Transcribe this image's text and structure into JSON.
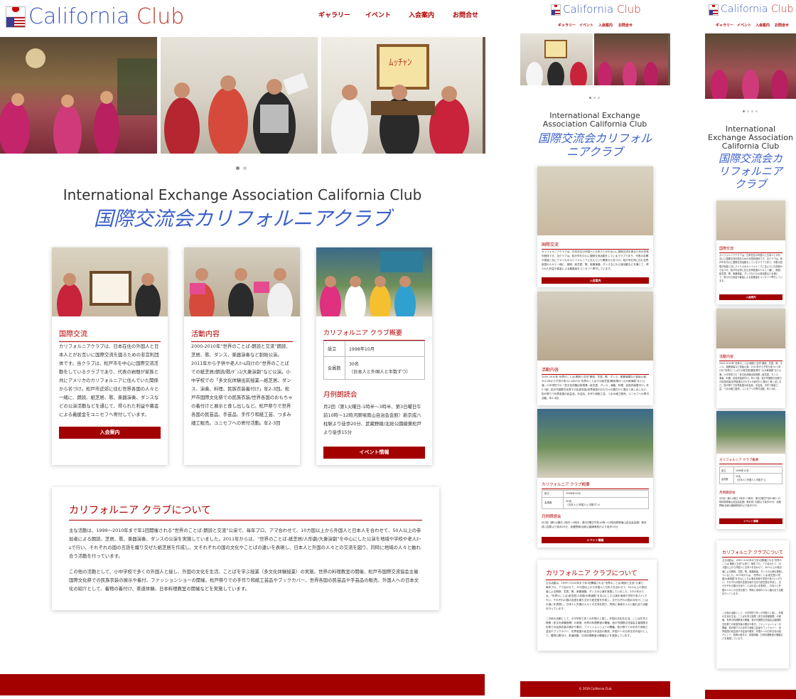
{
  "brand": {
    "logo_word1": "California",
    "logo_word2": "Club",
    "accent_color": "#a30000",
    "title_blue": "#3a5fc8"
  },
  "nav": [
    {
      "label": "ギャラリー"
    },
    {
      "label": "イベント"
    },
    {
      "label": "入会案内"
    },
    {
      "label": "お問合せ"
    }
  ],
  "hero": {
    "title_en": "International Exchange Association California Club",
    "title_jp": "国際交流会カリフォルニアクラブ",
    "mobile_title_en_line1": "International Exchange",
    "mobile_title_en_line2": "Association California Club",
    "mobile_title_jp_line1": "国際交流会カリフォル",
    "mobile_title_jp_line2": "ニアクラブ",
    "narrow_title_en_line1": "International",
    "narrow_title_en_line2": "Exchange Association",
    "narrow_title_en_line3": "California Club",
    "narrow_title_jp_line1": "国際交流会カ",
    "narrow_title_jp_line2": "リフォルニア",
    "narrow_title_jp_line3": "クラブ"
  },
  "cards": {
    "exchange": {
      "heading": "国際交流",
      "body": "カリフォルニアクラブは、日本在住の外国人と日本人とがお互いに国際交流を図るための非営利団体です。当クラブは、松戸市を中心に国際交流活動をしているクラブであり、代表の岩間が家族と共にアメリカのカリフォルニアに住んでいた関係から名づけ。松戸市近郊に住む世界各国の人々と一緒に、朗読、紙芝居、歌、楽器演奏、ダンスなどの公演活動などを通じて、得られた利益や募金による義援金をユニセフへ寄付しています。",
      "button": "入会案内"
    },
    "activity": {
      "heading": "活動内容",
      "body": "2000-2010年“世界のことば-朗読と交流”朗読、芝居、歌、ダンス、楽器演奏など創始公演。2011年から子供や老人ﾎｰﾑ向けの“世界のことばでの紙芝居/朗読/歌/ﾀﾞﾝｽ/大衆演劇”など公演。小中学校での「多文化体験出前授業―紙芝居、ダンス、演奏、料理、民族衣装着付け」年2-3回。松戸市国際文化祭での民族衣装/世界各国のおもちゃの着付けと展示と食し出しなど。松戸祭りで世界各国の民芸品、手芸品、手作り和紙工芸、つまみ細工販売。ユニセフへの寄付活動。年2-3回"
    },
    "overview": {
      "heading": "カリフォルニア クラブ概要",
      "row1_label": "設立",
      "row1_value": "1998年10月",
      "row2_label": "会員数",
      "row2_value": "30名",
      "row2_note": "（日本人と外国人と半数ずつ）",
      "reading_heading": "月例朗読会",
      "reading_body": "月2回（第1火曜日-1時半〜3時半、第3日曜日午前10時〜12時河原塚南山自治会会館）新京成八柱駅より徒歩20分、武蔵野線/北総公園線東松戸より徒歩15分",
      "button": "イベント情報"
    }
  },
  "about": {
    "heading": "カリフォルニア クラブについて",
    "para1": "主な活動は、1999〜2010年まで年1回開催される“世界のことば-朗読と交流”公演で、毎年プロ、アマ合わせて、10カ国以上から外国人と日本人を合わせて、50人以上の参加者による朗読、芝居、歌、楽器演奏、ダンスの公演を実施していました。2011年からは、“世界のことば-紙芝居/人形劇/大衆演劇”を中心にした公演を地域や学校や老人ﾎｰﾑで行い、それぞれの国の言語を織り交ぜた紙芝居を作成し、文それぞれの国の文化やことばの違いを表現し、日本人と外国の人々との交流を図り、同時に地域の人々と触れ合う活動を行っています。",
    "para2": "この他の活動として、小中学校で多くの外国人と接し、外国の文化を生活、ことばを学ぶ授業（多文化体験授業）の実施、世界の料理教室の開催、松戸市国際交流協会主催国際文化祭での民族衣装の展示や着付、ファッションショーの開催、松戸祭りでの手作り和紙工芸品やブックカバー、世界各国の民芸品や手芸品の販売、外国人への日本文化の紹介として、着物の着付け、茶道体験、日本料理教室の開催などを実施しています。"
  },
  "footer": {
    "copyright": "© 2019 California Club"
  }
}
